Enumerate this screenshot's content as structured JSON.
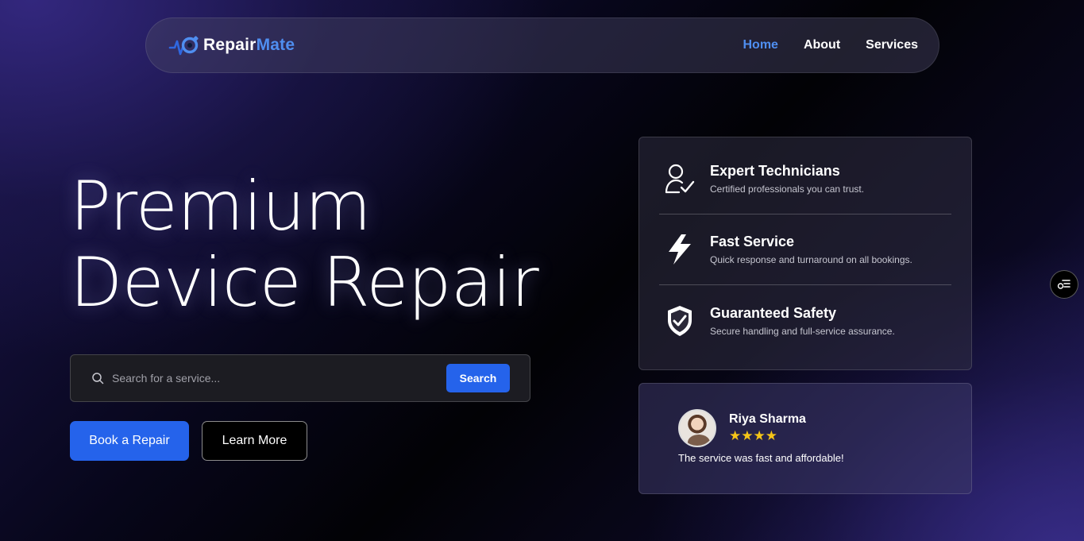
{
  "brand": {
    "name_part1": "Repair",
    "name_part2": "Mate"
  },
  "nav": {
    "items": [
      {
        "label": "Home",
        "active": true
      },
      {
        "label": "About",
        "active": false
      },
      {
        "label": "Services",
        "active": false
      }
    ]
  },
  "hero": {
    "title_line1": "Premium",
    "title_line2": "Device Repair",
    "search_placeholder": "Search for a service...",
    "search_button": "Search",
    "primary_button": "Book a Repair",
    "secondary_button": "Learn More"
  },
  "features": [
    {
      "icon": "user-check-icon",
      "title": "Expert Technicians",
      "description": "Certified professionals you can trust."
    },
    {
      "icon": "lightning-icon",
      "title": "Fast Service",
      "description": "Quick response and turnaround on all bookings."
    },
    {
      "icon": "shield-check-icon",
      "title": "Guaranteed Safety",
      "description": "Secure handling and full-service assurance."
    }
  ],
  "testimonial": {
    "name": "Riya Sharma",
    "stars": "★★★★",
    "quote": "The service was fast and affordable!"
  },
  "colors": {
    "accent": "#2563eb",
    "brand_blue": "#4f8ef0",
    "star": "#f5c518"
  }
}
